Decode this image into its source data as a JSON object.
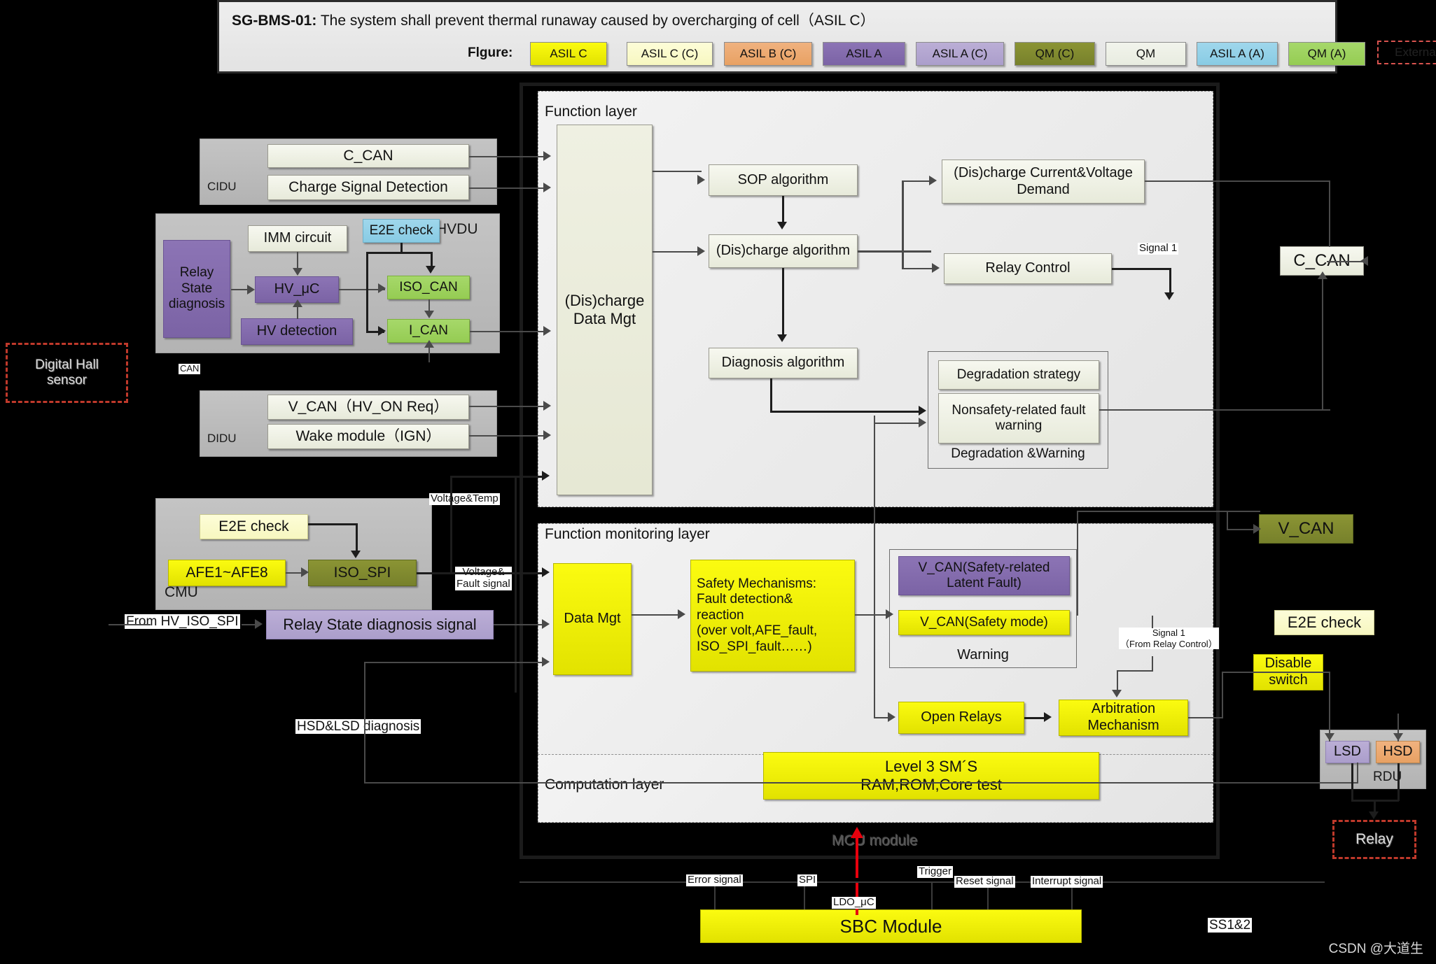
{
  "header": {
    "requirement_id": "SG-BMS-01:",
    "requirement_text": "The system shall prevent thermal runaway caused by overcharging of cell（ASIL C）",
    "legend_label": "Flgure:",
    "legend": [
      {
        "label": "ASIL C",
        "style": "yellow",
        "color": "#fbfb10"
      },
      {
        "label": "ASIL C (C)",
        "style": "lightyel",
        "color": "#fdfdd8"
      },
      {
        "label": "ASIL B (C)",
        "style": "orange",
        "color": "#f0b27f"
      },
      {
        "label": "ASIL A",
        "style": "purple",
        "color": "#8c74b5"
      },
      {
        "label": "ASIL A (C)",
        "style": "lpurple",
        "color": "#bbaed6"
      },
      {
        "label": "QM (C)",
        "style": "olive",
        "color": "#8b9434"
      },
      {
        "label": "QM",
        "style": "white",
        "color": "#f2f4ec"
      },
      {
        "label": "ASIL A (A)",
        "style": "skyblue",
        "color": "#9fd7ec"
      },
      {
        "label": "QM (A)",
        "style": "green",
        "color": "#a6d86a"
      },
      {
        "label": "External devices",
        "style": "dashred",
        "color": "#c0392b"
      }
    ]
  },
  "external": {
    "digital_hall_sensor": "Digital Hall\nsensor",
    "digital_hall_sensor_line1": "Digital Hall",
    "digital_hall_sensor_line2": "sensor",
    "relay": "Relay"
  },
  "cidu": {
    "panel_label": "CIDU",
    "items": [
      {
        "label": "C_CAN"
      },
      {
        "label": "Charge Signal Detection"
      }
    ]
  },
  "hvdu": {
    "panel_label": "HVDU",
    "relay_state_diagnosis": "Relay\nState\ndiagnosis",
    "relay_state_diagnosis_lines": [
      "Relay",
      "State",
      "diagnosis"
    ],
    "imm_circuit": "IMM circuit",
    "hv_mcu": "HV_μC",
    "hv_detection": "HV detection",
    "e2e_check": "E2E check",
    "iso_can": "ISO_CAN",
    "i_can": "I_CAN",
    "bus_tag": "CAN"
  },
  "didu": {
    "panel_label": "DIDU",
    "items": [
      {
        "label": "V_CAN（HV_ON Req）"
      },
      {
        "label": "Wake module（IGN）"
      }
    ]
  },
  "cmu": {
    "panel_label": "CMU",
    "e2e_check": "E2E check",
    "afe": "AFE1~AFE8",
    "iso_spi": "ISO_SPI"
  },
  "signals": {
    "voltage_temp": "Voltage&Temp",
    "voltage_fault_line1": "Voltage&",
    "voltage_fault_line2": "Fault signal",
    "from_hv_iso_spi": "From HV_ISO_SPI",
    "relay_state_diagnosis_signal": "Relay State diagnosis signal",
    "hsd_lsd_diagnosis": "HSD&LSD diagnosis",
    "signal1": "Signal 1",
    "signal1_from_line1": "Signal 1",
    "signal1_from_line2": "（From Relay Control）",
    "ss12": "SS1&2"
  },
  "ecu": {
    "function_layer": {
      "title": "Function layer",
      "data_mgt_line1": "(Dis)charge",
      "data_mgt_line2": "Data Mgt",
      "sop_algorithm": "SOP algorithm",
      "discharge_algorithm": "(Dis)charge algorithm",
      "diagnosis_algorithm": "Diagnosis algorithm",
      "current_voltage_demand_line1": "(Dis)charge  Current&Voltage",
      "current_voltage_demand_line2": "Demand",
      "relay_control": "Relay Control",
      "degradation_group_label": "Degradation &Warning",
      "degradation_strategy": "Degradation strategy",
      "nonsafety_fault_warning_line1": "Nonsafety-related  fault",
      "nonsafety_fault_warning_line2": "warning"
    },
    "function_monitoring_layer": {
      "title": "Function monitoring layer",
      "data_mgt": "Data Mgt",
      "safety_mechanisms": [
        "Safety Mechanisms:",
        "Fault detection&",
        "reaction",
        "(over volt,AFE_fault,",
        "ISO_SPI_fault……)"
      ],
      "warning_group_label": "Warning",
      "vcan_latent_fault_line1": "V_CAN(Safety-related",
      "vcan_latent_fault_line2": "Latent Fault)",
      "vcan_safety_mode": "V_CAN(Safety mode)",
      "open_relays": "Open Relays",
      "arbitration_line1": "Arbitration",
      "arbitration_line2": "Mechanism"
    },
    "computation_layer": {
      "title": "Computation layer",
      "level3_line1": "Level 3 SM´S",
      "level3_line2": "RAM,ROM,Core test"
    },
    "mcu_module_label": "MCU module"
  },
  "sbc": {
    "title": "SBC Module",
    "pins": [
      {
        "label": "Error signal"
      },
      {
        "label": "SPI"
      },
      {
        "label": "LDO_μC"
      },
      {
        "label": "Trigger"
      },
      {
        "label": "Reset  signal"
      },
      {
        "label": "Interrupt  signal"
      }
    ]
  },
  "right_side": {
    "c_can": "C_CAN",
    "v_can": "V_CAN",
    "e2e_check": "E2E check",
    "disable_switch_line1": "Disable",
    "disable_switch_line2": "switch",
    "rdu_label": "RDU",
    "lsd": "LSD",
    "hsd": "HSD"
  },
  "watermark": "CSDN @大道生"
}
